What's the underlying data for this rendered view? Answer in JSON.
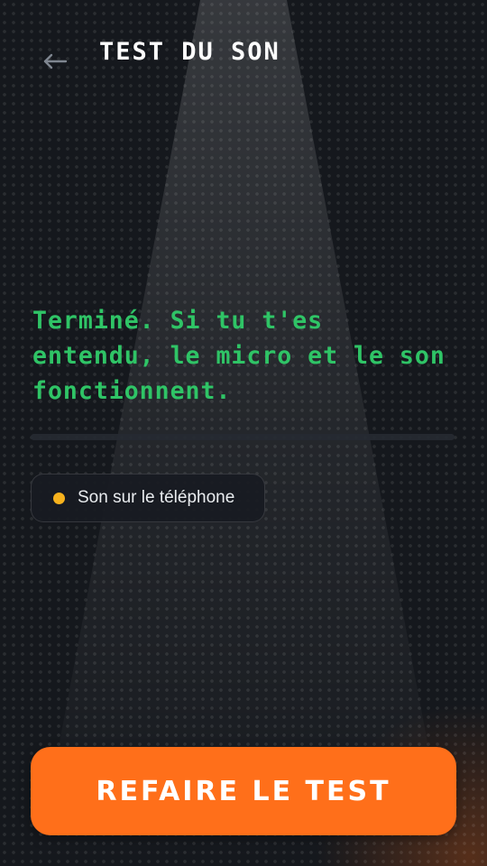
{
  "header": {
    "back_icon": "arrow-left-icon",
    "title": "TEST DU SON"
  },
  "main": {
    "status_message": "Terminé. Si tu t'es entendu, le micro et le son fonctionnent.",
    "status_chip": {
      "label": "Son sur le téléphone",
      "dot_color": "#f7b21d"
    }
  },
  "footer": {
    "retry_label": "REFAIRE LE TEST"
  },
  "colors": {
    "accent": "#ff6f1a",
    "success": "#2fc466",
    "background": "#15181d"
  }
}
